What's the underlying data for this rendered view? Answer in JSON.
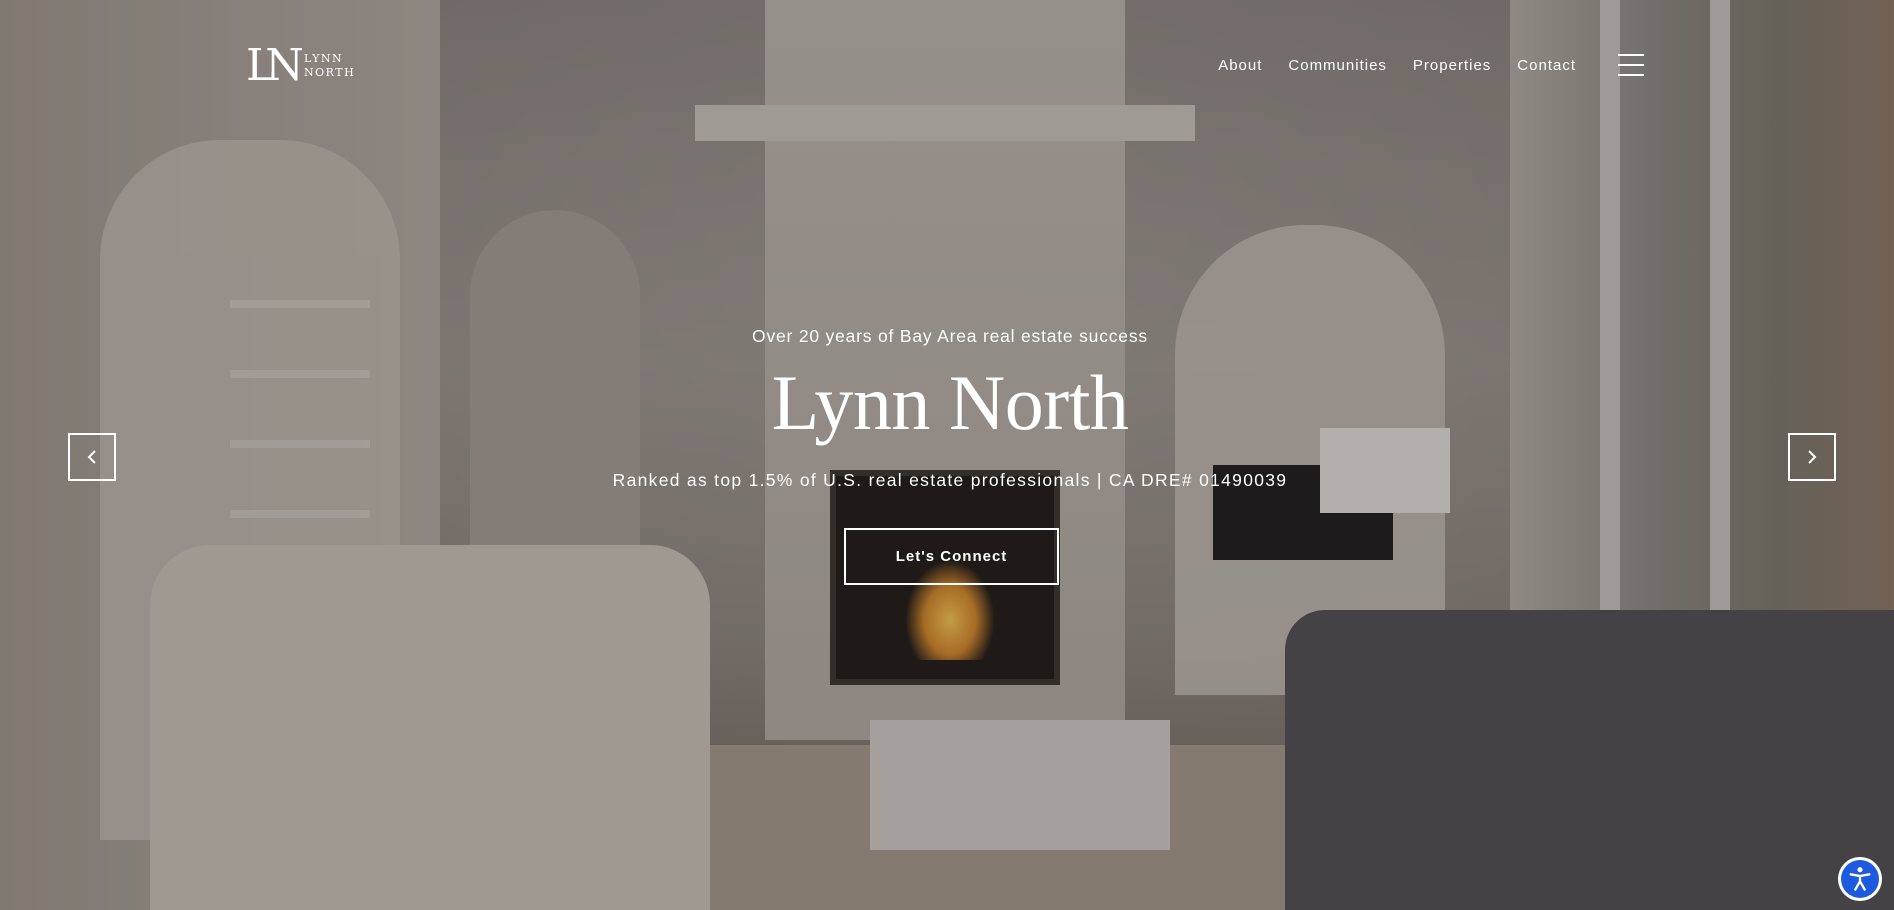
{
  "brand": {
    "mark": "LN",
    "line1": "LYNN",
    "line2": "NORTH"
  },
  "nav": {
    "items": [
      {
        "label": "About"
      },
      {
        "label": "Communities"
      },
      {
        "label": "Properties"
      },
      {
        "label": "Contact"
      }
    ],
    "menu_icon": "hamburger-menu-icon"
  },
  "hero": {
    "tagline": "Over 20 years of Bay Area real estate success",
    "title": "Lynn North",
    "subline": "Ranked as top 1.5% of U.S. real estate professionals | CA DRE# 01490039",
    "cta_label": "Let's Connect",
    "prev_icon": "chevron-left-icon",
    "next_icon": "chevron-right-icon"
  },
  "accessibility": {
    "icon": "accessibility-icon",
    "color": "#1e5adf"
  }
}
